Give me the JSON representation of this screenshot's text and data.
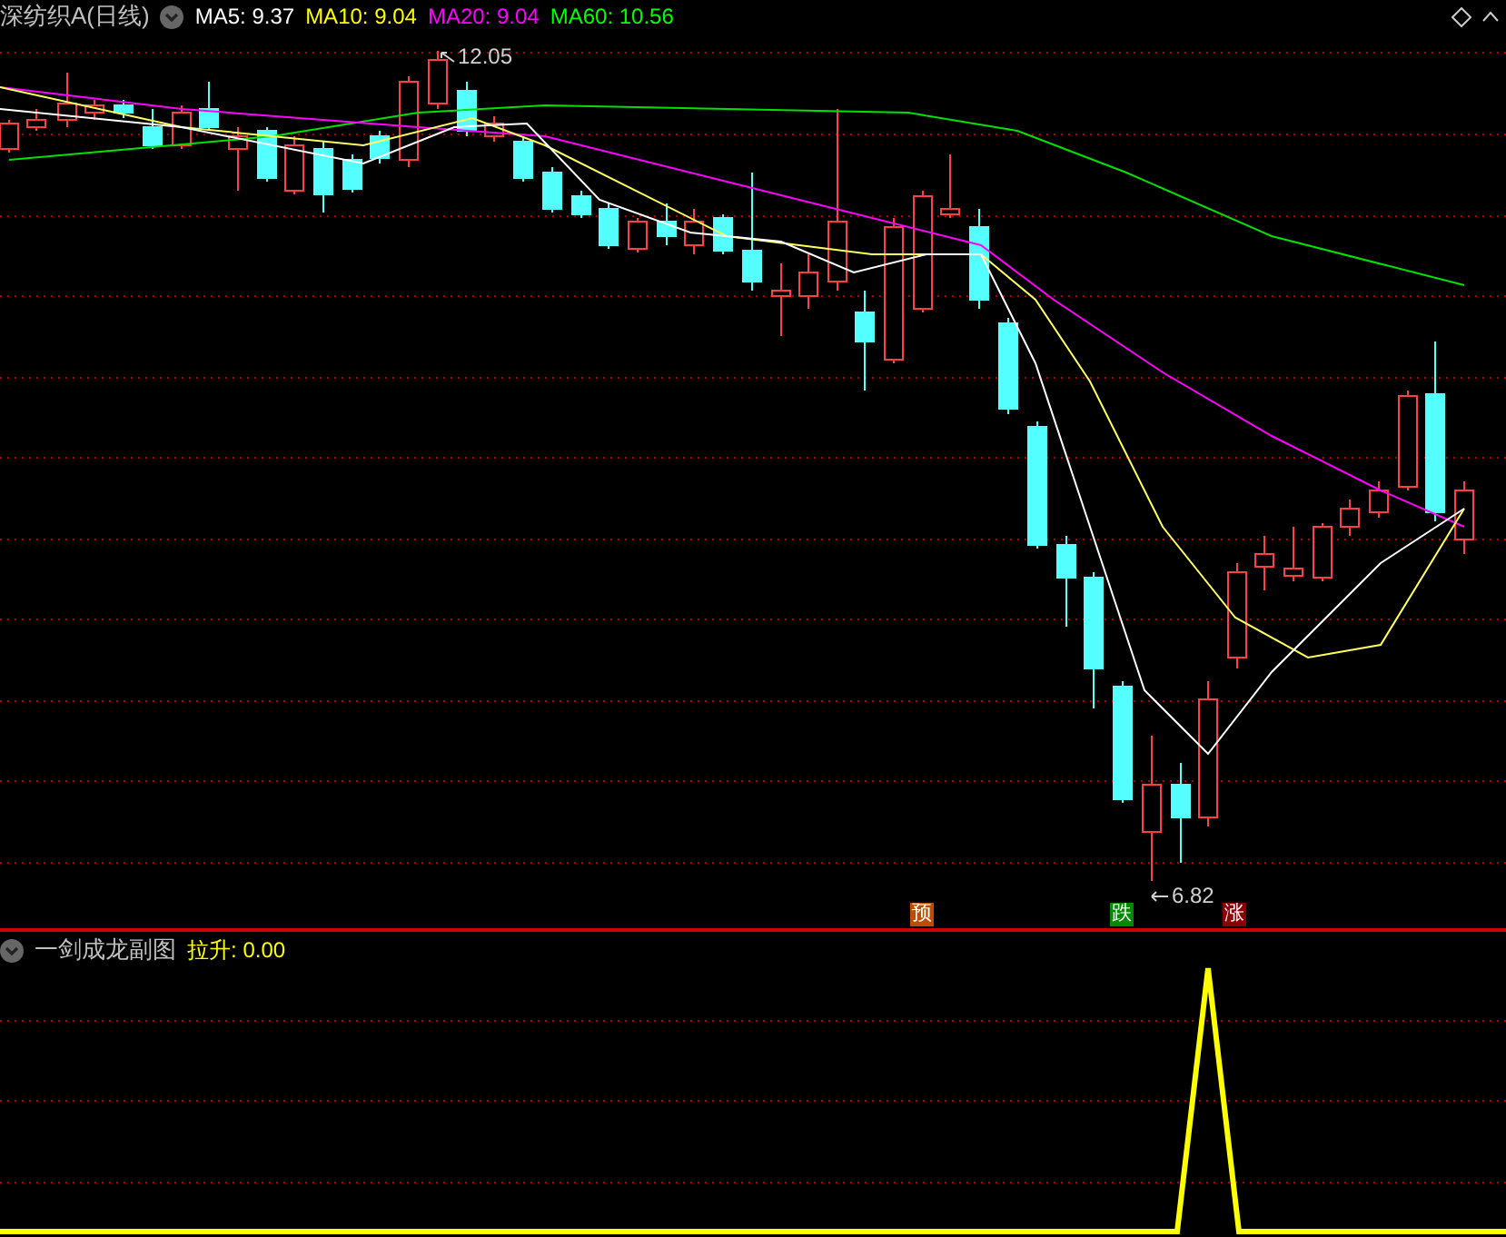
{
  "header": {
    "title": "深纺织A(日线)",
    "indicators": [
      {
        "label": "MA5:",
        "value": "9.37",
        "color": "#ffffff"
      },
      {
        "label": "MA10:",
        "value": "9.04",
        "color": "#ffff00"
      },
      {
        "label": "MA20:",
        "value": "9.04",
        "color": "#ff00ff"
      },
      {
        "label": "MA60:",
        "value": "10.56",
        "color": "#00ff00"
      }
    ]
  },
  "main_chart": {
    "high_label": "12.05",
    "low_label": "6.82",
    "signals": [
      {
        "text": "预",
        "color": "#c04a00"
      },
      {
        "text": "跌",
        "color": "#008a00"
      },
      {
        "text": "涨",
        "color": "#8b0000"
      }
    ]
  },
  "sub_chart": {
    "title": "一剑成龙副图",
    "indicator": {
      "label": "拉升:",
      "value": "0.00"
    }
  }
}
